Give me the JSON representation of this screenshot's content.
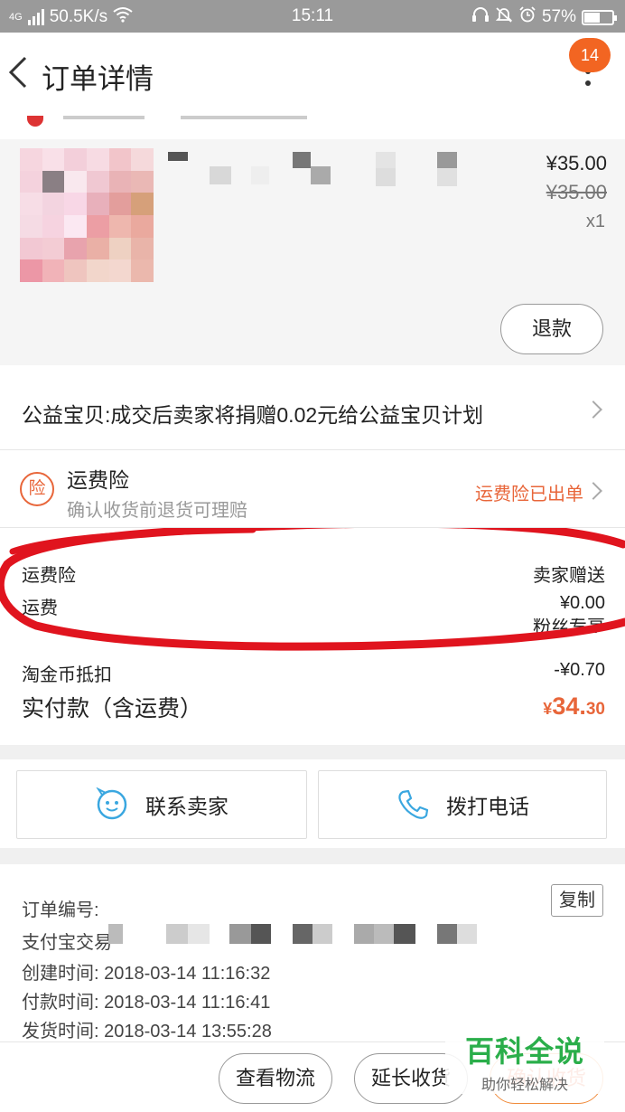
{
  "status_bar": {
    "network_type": "4G",
    "speed": "50.5K/s",
    "time": "15:11",
    "battery": "57%"
  },
  "header": {
    "title": "订单详情",
    "badge_count": "14"
  },
  "product": {
    "price": "¥35.00",
    "original_price": "¥35.00",
    "quantity": "x1",
    "refund_label": "退款"
  },
  "charity": {
    "text": "公益宝贝:成交后卖家将捐赠0.02元给公益宝贝计划"
  },
  "insurance": {
    "icon_char": "险",
    "title": "运费险",
    "subtitle": "确认收货前退货可理赔",
    "status": "运费险已出单"
  },
  "fees": {
    "rows": [
      {
        "label": "运费险",
        "value": "卖家赠送"
      },
      {
        "label": "运费",
        "value": "¥0.00"
      },
      {
        "label": "淘金币抵扣",
        "value": "-¥0.70"
      }
    ],
    "partial_label": "粉丝专享",
    "total_label": "实付款（含运费）",
    "total_currency": "¥",
    "total_int": "34.",
    "total_dec": "30"
  },
  "contact": {
    "seller_label": "联系卖家",
    "phone_label": "拨打电话"
  },
  "order_info": {
    "order_no_label": "订单编号:",
    "alipay_label": "支付宝交易",
    "copy_label": "复制",
    "times": [
      {
        "label": "创建时间:",
        "value": "2018-03-14 11:16:32"
      },
      {
        "label": "付款时间:",
        "value": "2018-03-14 11:16:41"
      },
      {
        "label": "发货时间:",
        "value": "2018-03-14 13:55:28"
      }
    ]
  },
  "bottom_bar": {
    "logistics_label": "查看物流",
    "extend_label": "延长收货",
    "confirm_label": "确认收货"
  },
  "watermark": {
    "title": "百科全说",
    "subtitle": "助你轻松解决"
  },
  "colors": {
    "accent": "#e8663a",
    "badge": "#f26522",
    "annotation_red": "#e0141e",
    "watermark_green": "#2aae4a"
  }
}
